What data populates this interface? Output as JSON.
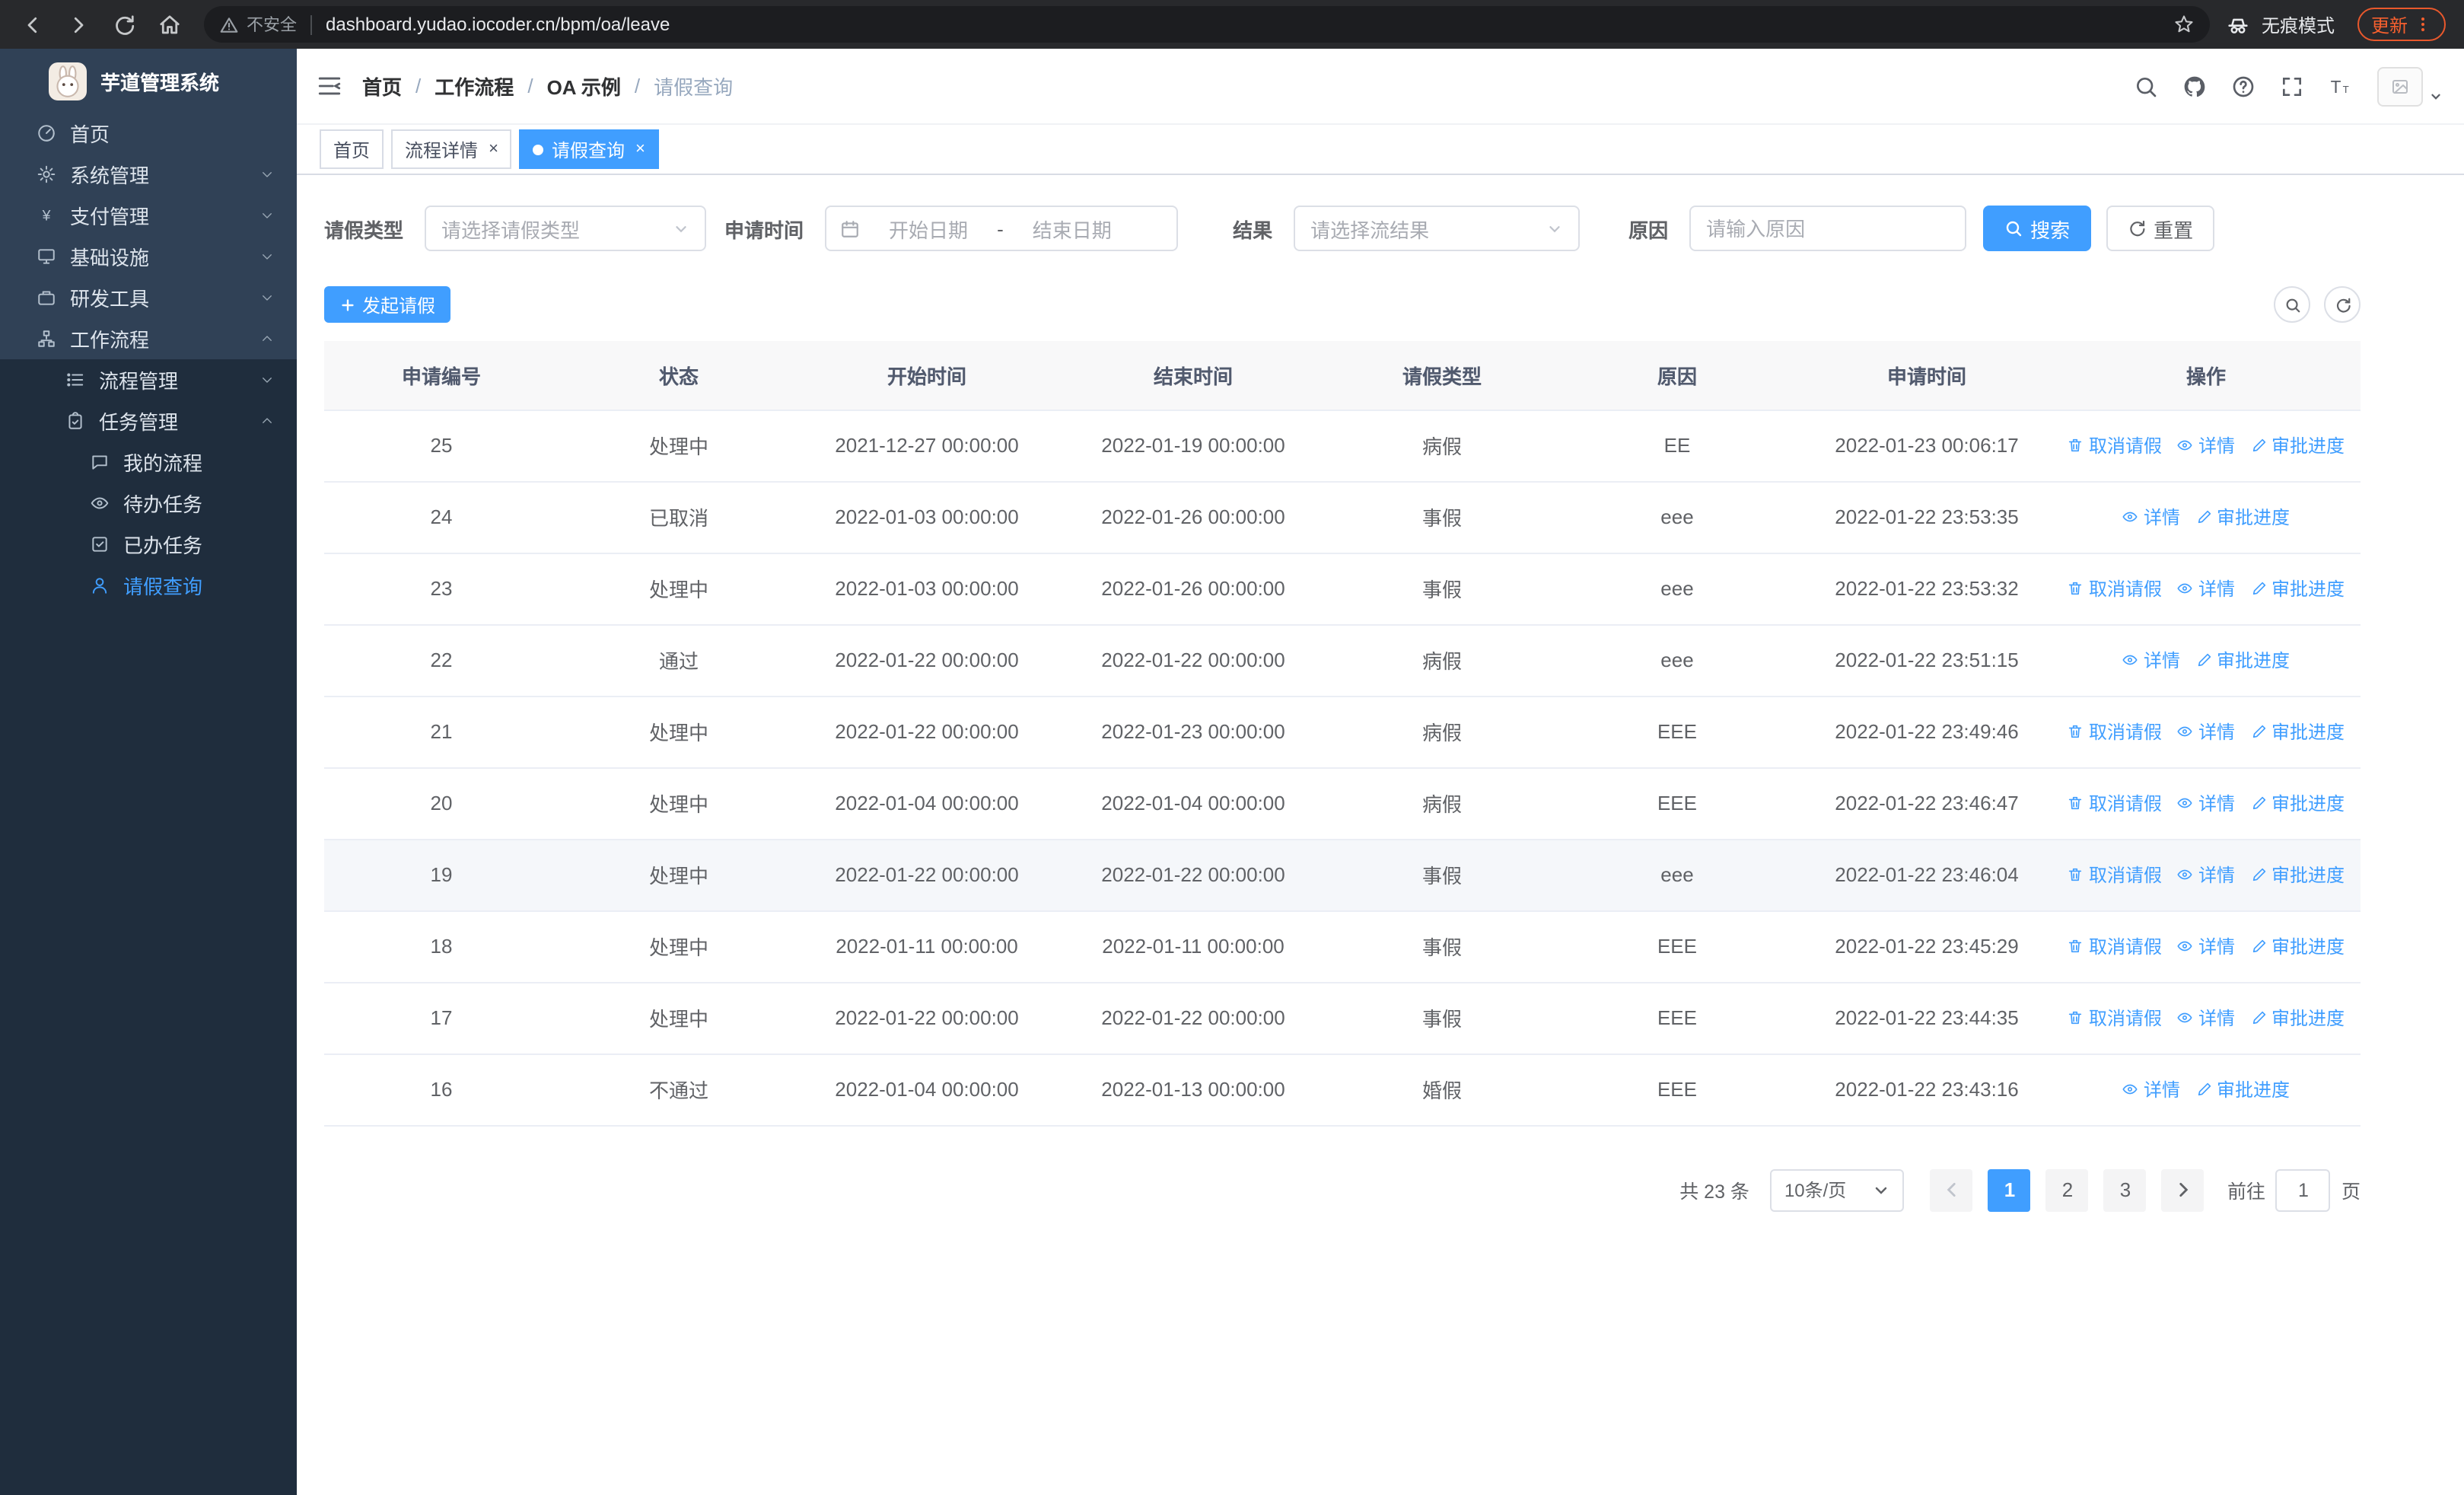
{
  "browser": {
    "security_label": "不安全",
    "url": "dashboard.yudao.iocoder.cn/bpm/oa/leave",
    "incognito_label": "无痕模式",
    "update_label": "更新"
  },
  "sidebar": {
    "logo_title": "芋道管理系统",
    "items": [
      {
        "label": "首页",
        "icon": "dashboard-icon",
        "chevron": null,
        "active": false
      },
      {
        "label": "系统管理",
        "icon": "gear-icon",
        "chevron": "down",
        "active": false
      },
      {
        "label": "支付管理",
        "icon": "payment-icon",
        "chevron": "down",
        "active": false
      },
      {
        "label": "基础设施",
        "icon": "infrastructure-icon",
        "chevron": "down",
        "active": false
      },
      {
        "label": "研发工具",
        "icon": "devtools-icon",
        "chevron": "down",
        "active": false
      },
      {
        "label": "工作流程",
        "icon": "workflow-icon",
        "chevron": "up",
        "active": false
      }
    ],
    "workflow_children": [
      {
        "label": "流程管理",
        "icon": "process-mgmt-icon",
        "chevron": "down",
        "level": 2,
        "active": false
      },
      {
        "label": "任务管理",
        "icon": "task-mgmt-icon",
        "chevron": "up",
        "level": 2,
        "active": false
      },
      {
        "label": "我的流程",
        "icon": "my-process-icon",
        "chevron": null,
        "level": 3,
        "active": false
      },
      {
        "label": "待办任务",
        "icon": "todo-tasks-icon",
        "chevron": null,
        "level": 3,
        "active": false
      },
      {
        "label": "已办任务",
        "icon": "done-tasks-icon",
        "chevron": null,
        "level": 3,
        "active": false
      },
      {
        "label": "请假查询",
        "icon": "leave-user-icon",
        "chevron": null,
        "level": 3,
        "active": true
      }
    ]
  },
  "header": {
    "breadcrumb": [
      "首页",
      "工作流程",
      "OA 示例",
      "请假查询"
    ],
    "separator": "/"
  },
  "tabs": [
    {
      "label": "首页",
      "closable": false,
      "active": false
    },
    {
      "label": "流程详情",
      "closable": true,
      "active": false
    },
    {
      "label": "请假查询",
      "closable": true,
      "active": true
    }
  ],
  "filters": {
    "leave_type_label": "请假类型",
    "leave_type_placeholder": "请选择请假类型",
    "apply_time_label": "申请时间",
    "start_date_placeholder": "开始日期",
    "range_separator": "-",
    "end_date_placeholder": "结束日期",
    "result_label": "结果",
    "result_placeholder": "请选择流结果",
    "reason_label": "原因",
    "reason_placeholder": "请输入原因",
    "search_button": "搜索",
    "reset_button": "重置"
  },
  "toolbar": {
    "create_button": "发起请假"
  },
  "table": {
    "headers": [
      "申请编号",
      "状态",
      "开始时间",
      "结束时间",
      "请假类型",
      "原因",
      "申请时间",
      "操作"
    ],
    "actions": {
      "cancel": "取消请假",
      "detail": "详情",
      "progress": "审批进度"
    },
    "rows": [
      {
        "id": "25",
        "status": "处理中",
        "start": "2021-12-27 00:00:00",
        "end": "2022-01-19 00:00:00",
        "type": "病假",
        "reason": "EE",
        "applied": "2022-01-23 00:06:17",
        "cancellable": true,
        "hover": false
      },
      {
        "id": "24",
        "status": "已取消",
        "start": "2022-01-03 00:00:00",
        "end": "2022-01-26 00:00:00",
        "type": "事假",
        "reason": "eee",
        "applied": "2022-01-22 23:53:35",
        "cancellable": false,
        "hover": false
      },
      {
        "id": "23",
        "status": "处理中",
        "start": "2022-01-03 00:00:00",
        "end": "2022-01-26 00:00:00",
        "type": "事假",
        "reason": "eee",
        "applied": "2022-01-22 23:53:32",
        "cancellable": true,
        "hover": false
      },
      {
        "id": "22",
        "status": "通过",
        "start": "2022-01-22 00:00:00",
        "end": "2022-01-22 00:00:00",
        "type": "病假",
        "reason": "eee",
        "applied": "2022-01-22 23:51:15",
        "cancellable": false,
        "hover": false
      },
      {
        "id": "21",
        "status": "处理中",
        "start": "2022-01-22 00:00:00",
        "end": "2022-01-23 00:00:00",
        "type": "病假",
        "reason": "EEE",
        "applied": "2022-01-22 23:49:46",
        "cancellable": true,
        "hover": false
      },
      {
        "id": "20",
        "status": "处理中",
        "start": "2022-01-04 00:00:00",
        "end": "2022-01-04 00:00:00",
        "type": "病假",
        "reason": "EEE",
        "applied": "2022-01-22 23:46:47",
        "cancellable": true,
        "hover": false
      },
      {
        "id": "19",
        "status": "处理中",
        "start": "2022-01-22 00:00:00",
        "end": "2022-01-22 00:00:00",
        "type": "事假",
        "reason": "eee",
        "applied": "2022-01-22 23:46:04",
        "cancellable": true,
        "hover": true
      },
      {
        "id": "18",
        "status": "处理中",
        "start": "2022-01-11 00:00:00",
        "end": "2022-01-11 00:00:00",
        "type": "事假",
        "reason": "EEE",
        "applied": "2022-01-22 23:45:29",
        "cancellable": true,
        "hover": false
      },
      {
        "id": "17",
        "status": "处理中",
        "start": "2022-01-22 00:00:00",
        "end": "2022-01-22 00:00:00",
        "type": "事假",
        "reason": "EEE",
        "applied": "2022-01-22 23:44:35",
        "cancellable": true,
        "hover": false
      },
      {
        "id": "16",
        "status": "不通过",
        "start": "2022-01-04 00:00:00",
        "end": "2022-01-13 00:00:00",
        "type": "婚假",
        "reason": "EEE",
        "applied": "2022-01-22 23:43:16",
        "cancellable": false,
        "hover": false
      }
    ]
  },
  "pagination": {
    "total": "共 23 条",
    "page_size": "10条/页",
    "pages": [
      "1",
      "2",
      "3"
    ],
    "active_page": "1",
    "goto_label": "前往",
    "goto_value": "1",
    "goto_unit": "页"
  },
  "colors": {
    "primary": "#409eff",
    "sidebar_bg": "#304156",
    "submenu_bg": "#1f2d3d"
  }
}
